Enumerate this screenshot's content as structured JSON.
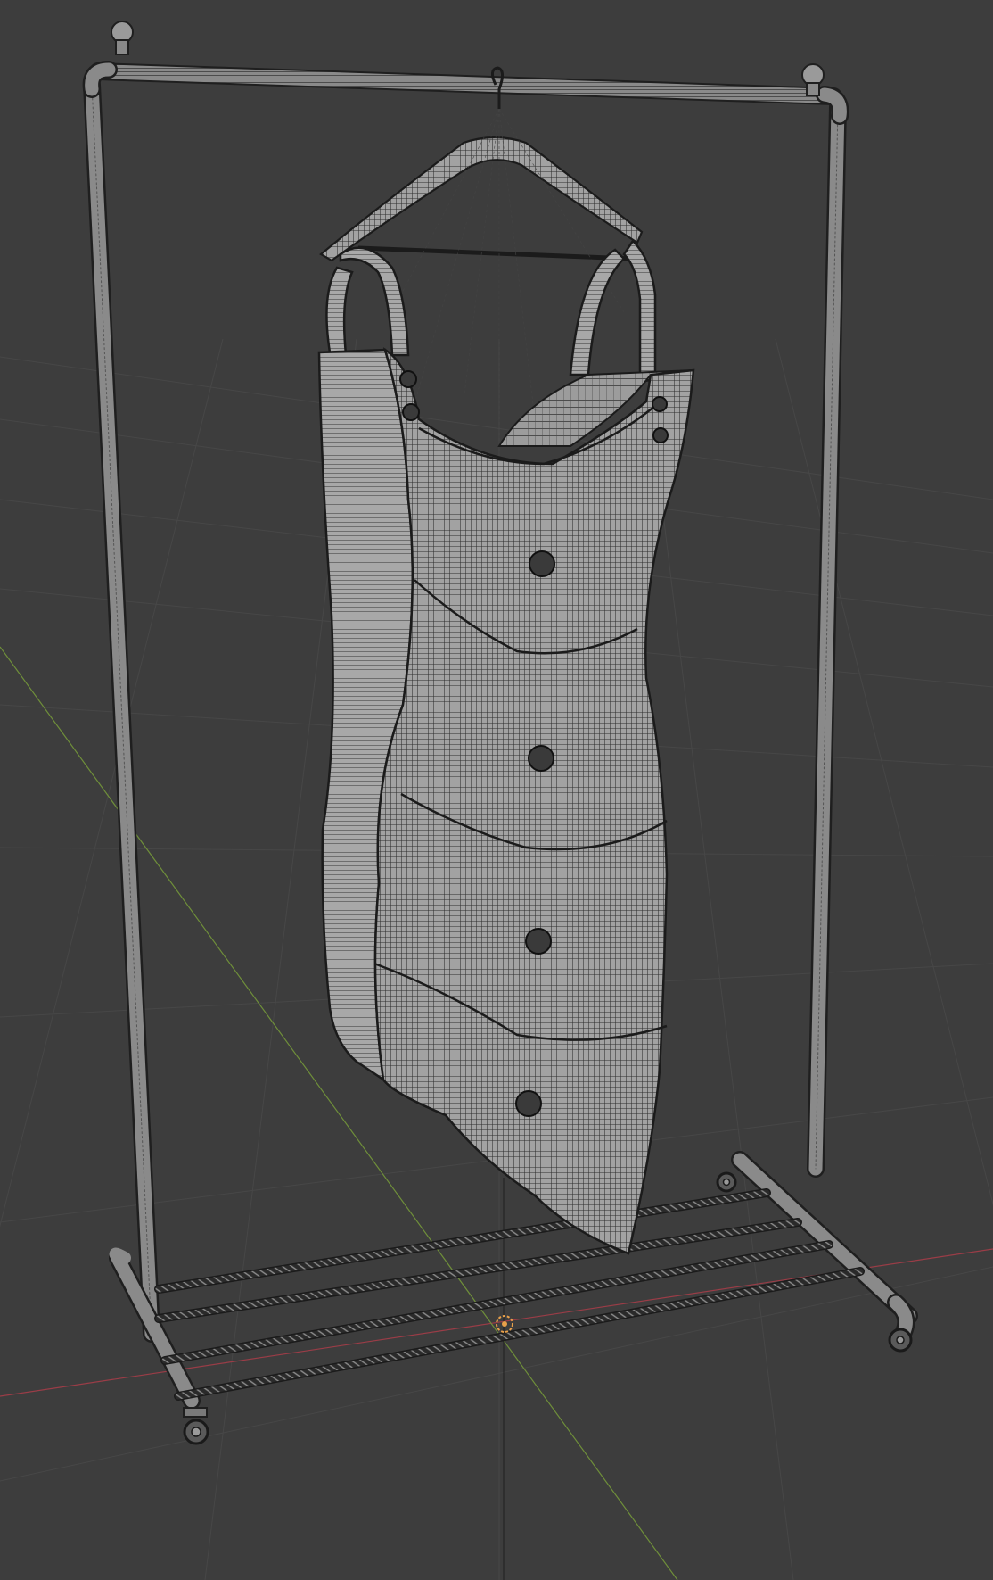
{
  "viewport": {
    "view": "3d-viewport",
    "shading": "wireframe-overlay",
    "colors": {
      "background": "#3d3d3d",
      "grid_line": "#474747",
      "mesh_fill": "#9a9a9a",
      "mesh_wire": "#262626",
      "axis_x": "#9a3d47",
      "axis_y": "#6f8f3a",
      "origin": "#e8a04a"
    }
  },
  "scene": {
    "objects": [
      {
        "name": "clothing-rack",
        "icon": "rack-mesh"
      },
      {
        "name": "dress",
        "icon": "dress-mesh"
      },
      {
        "name": "hanger",
        "icon": "hanger-mesh"
      },
      {
        "name": "shoe-shelf-bars",
        "icon": "bars-mesh"
      },
      {
        "name": "caster-wheels",
        "icon": "wheel-mesh"
      }
    ],
    "origin_marker": "object-origin-icon"
  }
}
